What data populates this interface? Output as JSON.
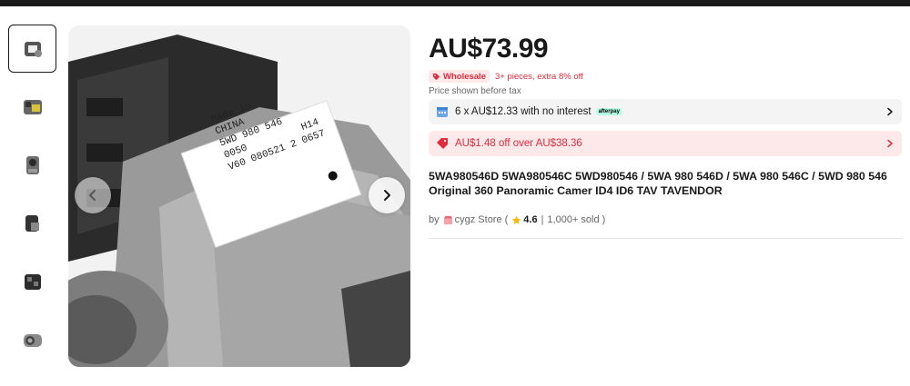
{
  "gallery": {
    "thumbnails": [
      "thumb-1",
      "thumb-2",
      "thumb-3",
      "thumb-4",
      "thumb-5",
      "thumb-6"
    ],
    "active_index": 0,
    "label_lines": [
      "Made in",
      "CHINA",
      "5WD 980 546",
      "0050",
      "H14",
      "V60 080521 2 0657"
    ]
  },
  "product": {
    "price": "AU$73.99",
    "wholesale_badge": "Wholesale",
    "wholesale_text": "3+ pieces, extra 8% off",
    "tax_note": "Price shown before tax",
    "installment_text": "6 x AU$12.33 with no interest",
    "installment_logo": "afterpay",
    "coupon_text": "AU$1.48 off over AU$38.36",
    "title": "5WA980546D 5WA980546C 5WD980546 / 5WA 980 546D / 5WA 980 546C / 5WD 980 546 Original 360 Panoramic Camer ID4 ID6 TAV TAVENDOR"
  },
  "store": {
    "by_label": "by",
    "name": "cygz Store",
    "open_paren": "(",
    "rating": "4.6",
    "separator": "|",
    "sold": "1,000+ sold",
    "close_paren": ")"
  },
  "icons": {
    "prev": "chevron-left-icon",
    "next": "chevron-right-icon",
    "tag": "tag-icon",
    "calendar": "calendar-icon",
    "coupon": "coupon-icon",
    "star": "star-icon",
    "store": "store-icon"
  },
  "colors": {
    "accent_red": "#e02c3b",
    "coupon_bg": "#fde8ea",
    "installment_bg": "#f4f4f4",
    "star": "#ffb800",
    "afterpay": "#b2fce4"
  }
}
